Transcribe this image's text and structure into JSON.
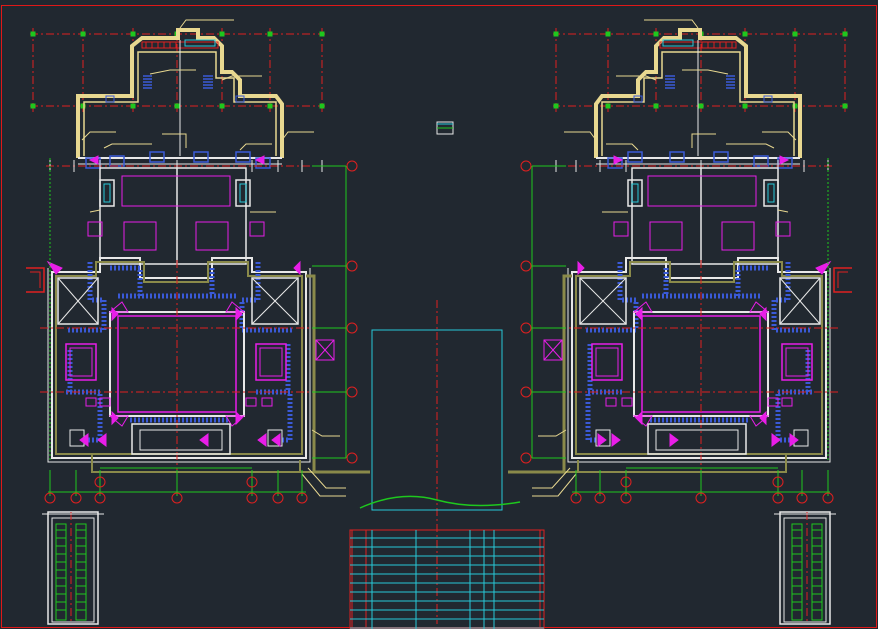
{
  "canvas": {
    "background": "#212830",
    "frame_color": "#e01818"
  },
  "drawing": {
    "type": "architectural-floor-plan",
    "plans": [
      "left-floor-plan",
      "right-floor-plan"
    ],
    "mirrored": true,
    "legend_table": {
      "rows": 11
    },
    "layer_colors": {
      "wall_white": "#e8e8e8",
      "axis_red": "#e02020",
      "dimension_green": "#1ec81e",
      "equipment_magenta": "#e81ee8",
      "hatch_blue": "#3a5ad8",
      "leader_yellow": "#e8d890",
      "elevator_cyan": "#28c8d8",
      "wall_olive": "#8a8a4a"
    }
  }
}
